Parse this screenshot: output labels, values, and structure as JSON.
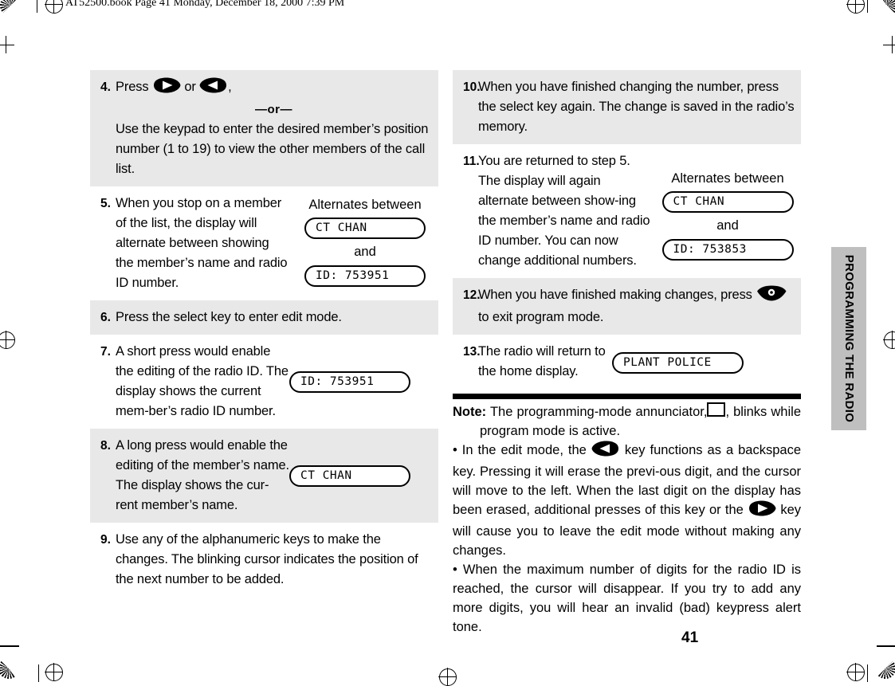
{
  "running_head": "AT52500.book  Page 41  Monday, December 18, 2000  7:39 PM",
  "folio": "41",
  "side_tab": {
    "label": "PROGRAMMING THE RADIO"
  },
  "left_column": {
    "steps": [
      {
        "number": "4.",
        "shaded": true,
        "line1_prefix": "Press",
        "line1_mid": "or",
        "line1_suffix": ",",
        "or_divider": "—or—",
        "paragraph": "Use the keypad to enter the desired member’s position number (1 to 19) to view the other members of the call list."
      },
      {
        "number": "5.",
        "shaded": false,
        "paragraph": "When you stop on a member of the list, the display will alternate between showing the member’s name and radio ID number.",
        "art": {
          "heading": "Alternates between",
          "lcd_top": "CT CHAN",
          "connector": "and",
          "lcd_bottom": "ID: 753951"
        }
      },
      {
        "number": "6.",
        "shaded": true,
        "paragraph": "Press the select key to enter edit mode."
      },
      {
        "number": "7.",
        "shaded": false,
        "paragraph": "A short press would enable the editing of the radio ID. The display shows the current mem-ber’s radio ID number.",
        "art": {
          "lcd": "ID: 753951"
        }
      },
      {
        "number": "8.",
        "shaded": true,
        "paragraph": "A long press would enable the editing of the member’s name. The display shows the cur-rent member’s name.",
        "art": {
          "lcd": "CT CHAN"
        }
      },
      {
        "number": "9.",
        "shaded": false,
        "paragraph": "Use any of the alphanumeric keys to make the changes. The blinking cursor indicates the position of the next number to be added."
      }
    ]
  },
  "right_column": {
    "steps": [
      {
        "number": "10.",
        "shaded": true,
        "paragraph": "When you have finished changing the number, press the select key again. The change is saved in the radio’s memory."
      },
      {
        "number": "11.",
        "shaded": false,
        "paragraph": "You are returned to step 5. The display will again alternate between show-ing the member’s name and radio ID number. You can now change additional numbers.",
        "art": {
          "heading": "Alternates between",
          "lcd_top": "CT CHAN",
          "connector": "and",
          "lcd_bottom": "ID: 753853"
        }
      },
      {
        "number": "12.",
        "shaded": true,
        "line_prefix": "When you have finished making changes, press",
        "line_suffix": "to exit program mode."
      },
      {
        "number": "13.",
        "shaded": false,
        "paragraph": "The radio will return to the home display.",
        "art": {
          "lcd": "PLANT POLICE"
        }
      }
    ],
    "note": {
      "label": "Note:",
      "sentence1_a": "The   programming-mode   annunciator,",
      "sentence1_b": ", blinks while program mode is active.",
      "bullet1_a": "•  In the edit mode, the",
      "bullet1_b": "key functions as a backspace key. Pressing it will erase the previ-ous digit, and the cursor will move to the left. When the last digit on the display has been erased, additional presses of this key or the",
      "bullet1_c": "key will cause you to leave the edit mode without making any changes.",
      "bullet2": "•  When the maximum number of digits for the radio ID is reached, the cursor will disappear. If you try to add any more digits, you will hear an invalid (bad) keypress alert tone."
    }
  },
  "icons": {
    "right_arrow_key": "right-arrow-key-icon",
    "left_arrow_key": "left-arrow-key-icon",
    "home_key": "home-key-icon",
    "annunciator": "annunciator-box-icon"
  },
  "colors": {
    "shade": "#e8e8e8",
    "tab": "#bfbfbf",
    "ink": "#000000",
    "paper": "#ffffff"
  }
}
